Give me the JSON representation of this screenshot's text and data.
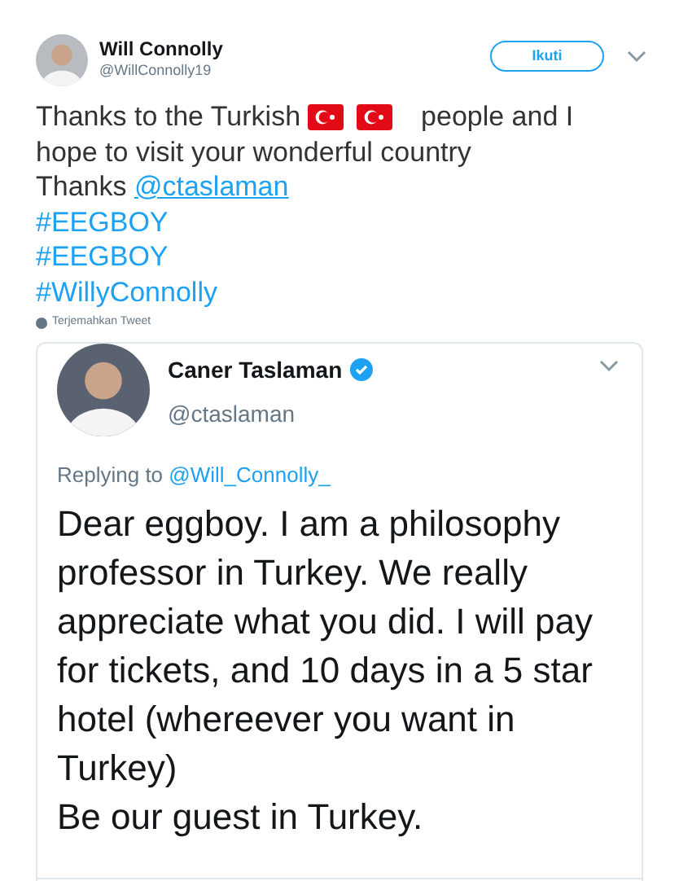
{
  "tweet": {
    "author": {
      "name": "Will Connolly",
      "handle": "@WillConnolly19"
    },
    "follow_button": "Ikuti",
    "text_before": "Thanks to the Turkish",
    "text_after": "people and I",
    "text_line2": "hope to visit your wonderful country",
    "thanks": "Thanks",
    "mention": "@ctaslaman",
    "hashtags": [
      "#EEGBOY",
      "#EEGBOY",
      "#WillyConnolly"
    ],
    "translate": "Terjemahkan Tweet"
  },
  "quoted_tweet": {
    "author": {
      "name": "Caner Taslaman",
      "handle": "@ctaslaman",
      "verified": true
    },
    "replying_prefix": "Replying to",
    "replying_to": "@Will_Connolly_",
    "text": "Dear eggboy. I am a philosophy professor in Turkey. We really appreciate what you did. I will pay for tickets, and 10 days in a 5 star hotel (whereever you want in Turkey)",
    "closing": "Be our guest in Turkey."
  }
}
